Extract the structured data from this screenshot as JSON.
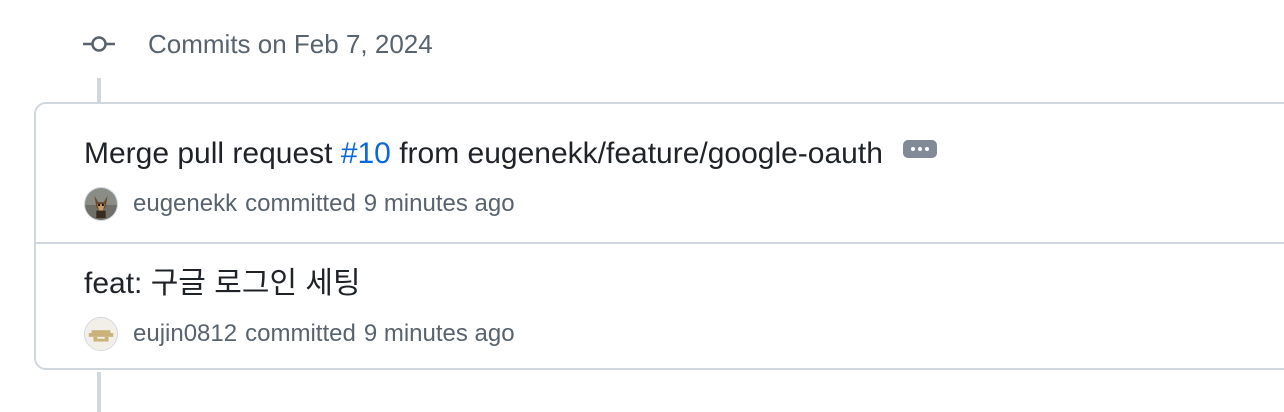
{
  "group": {
    "title": "Commits on Feb 7, 2024",
    "icon": "git-commit-icon"
  },
  "commits": [
    {
      "title_prefix": "Merge pull request ",
      "issue_link": "#10",
      "title_suffix": " from eugenekk/feature/google-oauth",
      "author": "eugenekk",
      "verb": "committed",
      "time": "9 minutes ago",
      "avatar_icon": "dog-avatar",
      "has_more_button": true
    },
    {
      "title": "feat: 구글 로그인 세팅",
      "author": "eujin0812",
      "verb": "committed",
      "time": "9 minutes ago",
      "avatar_icon": "identicon-avatar"
    }
  ],
  "colors": {
    "link": "#0969da",
    "muted_text": "#59636e",
    "border": "#d0d7de"
  }
}
